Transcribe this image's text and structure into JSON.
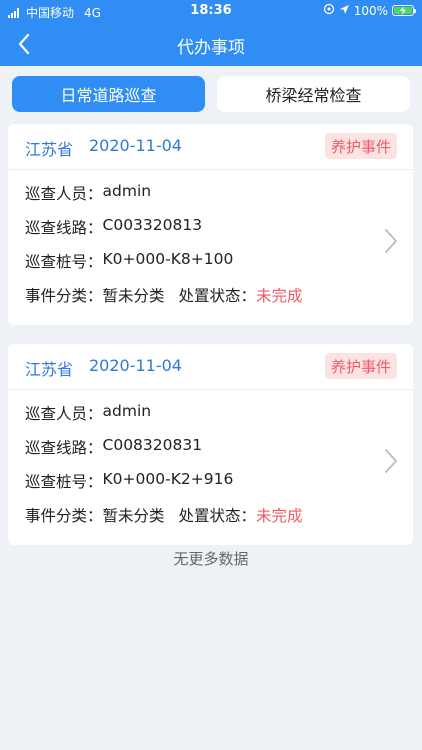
{
  "status_bar": {
    "carrier": "中国移动",
    "network": "4G",
    "time": "18:36",
    "battery": "100%"
  },
  "nav": {
    "title": "代办事项"
  },
  "tabs": [
    {
      "label": "日常道路巡查",
      "active": true
    },
    {
      "label": "桥梁经常检查",
      "active": false
    }
  ],
  "cards": [
    {
      "province": "江苏省",
      "date": "2020-11-04",
      "badge": "养护事件",
      "inspector_label": "巡查人员：",
      "inspector": "admin",
      "route_label": "巡查线路：",
      "route": "C003320813",
      "stake_label": "巡查桩号：",
      "stake": "K0+000-K8+100",
      "category_label": "事件分类：",
      "category": "暂未分类",
      "status_label": "处置状态：",
      "status": "未完成"
    },
    {
      "province": "江苏省",
      "date": "2020-11-04",
      "badge": "养护事件",
      "inspector_label": "巡查人员：",
      "inspector": "admin",
      "route_label": "巡查线路：",
      "route": "C008320831",
      "stake_label": "巡查桩号：",
      "stake": "K0+000-K2+916",
      "category_label": "事件分类：",
      "category": "暂未分类",
      "status_label": "处置状态：",
      "status": "未完成"
    }
  ],
  "footer": {
    "no_more": "无更多数据"
  },
  "colors": {
    "primary": "#2f8df3",
    "date_text": "#2f7ad6",
    "badge_bg": "#fbe3e4",
    "alert": "#ef5b66",
    "page_bg": "#eef1f6"
  }
}
